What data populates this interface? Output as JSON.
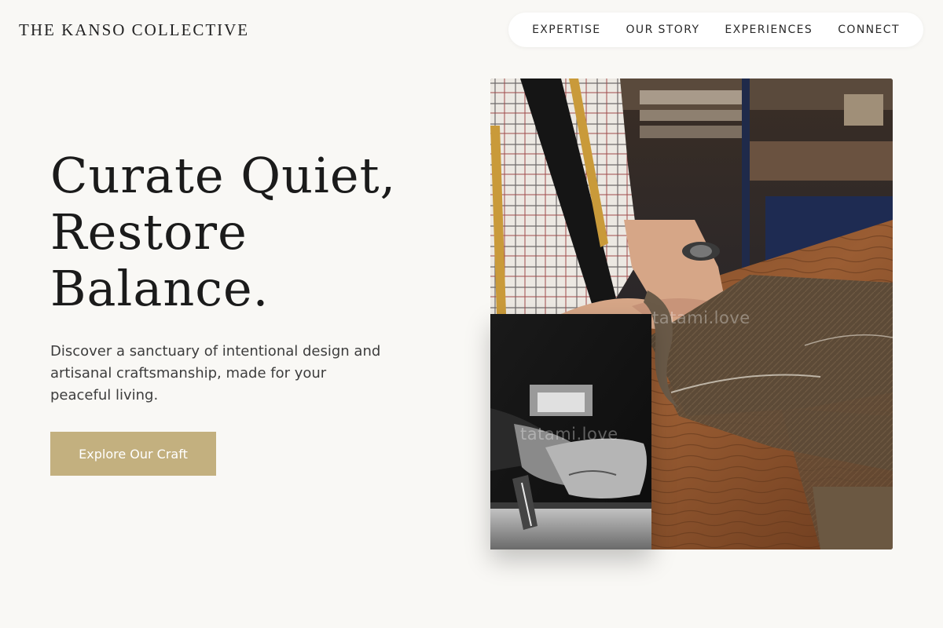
{
  "brand": {
    "name": "THE KANSO COLLECTIVE"
  },
  "nav": {
    "items": [
      {
        "label": "EXPERTISE"
      },
      {
        "label": "OUR STORY"
      },
      {
        "label": "EXPERIENCES"
      },
      {
        "label": "CONNECT"
      }
    ]
  },
  "hero": {
    "headline_lines": [
      "Curate Quiet,",
      "Restore",
      "Balance."
    ],
    "subtext": "Discover a sanctuary of intentional design and artisanal craftsmanship, made for your peaceful living.",
    "cta_label": "Explore Our Craft"
  },
  "images": {
    "main_watermark": "tatami.love",
    "inset_watermark": "tatami.love"
  },
  "colors": {
    "background": "#f9f8f5",
    "accent": "#c3b07f",
    "text": "#1b1b1b"
  }
}
